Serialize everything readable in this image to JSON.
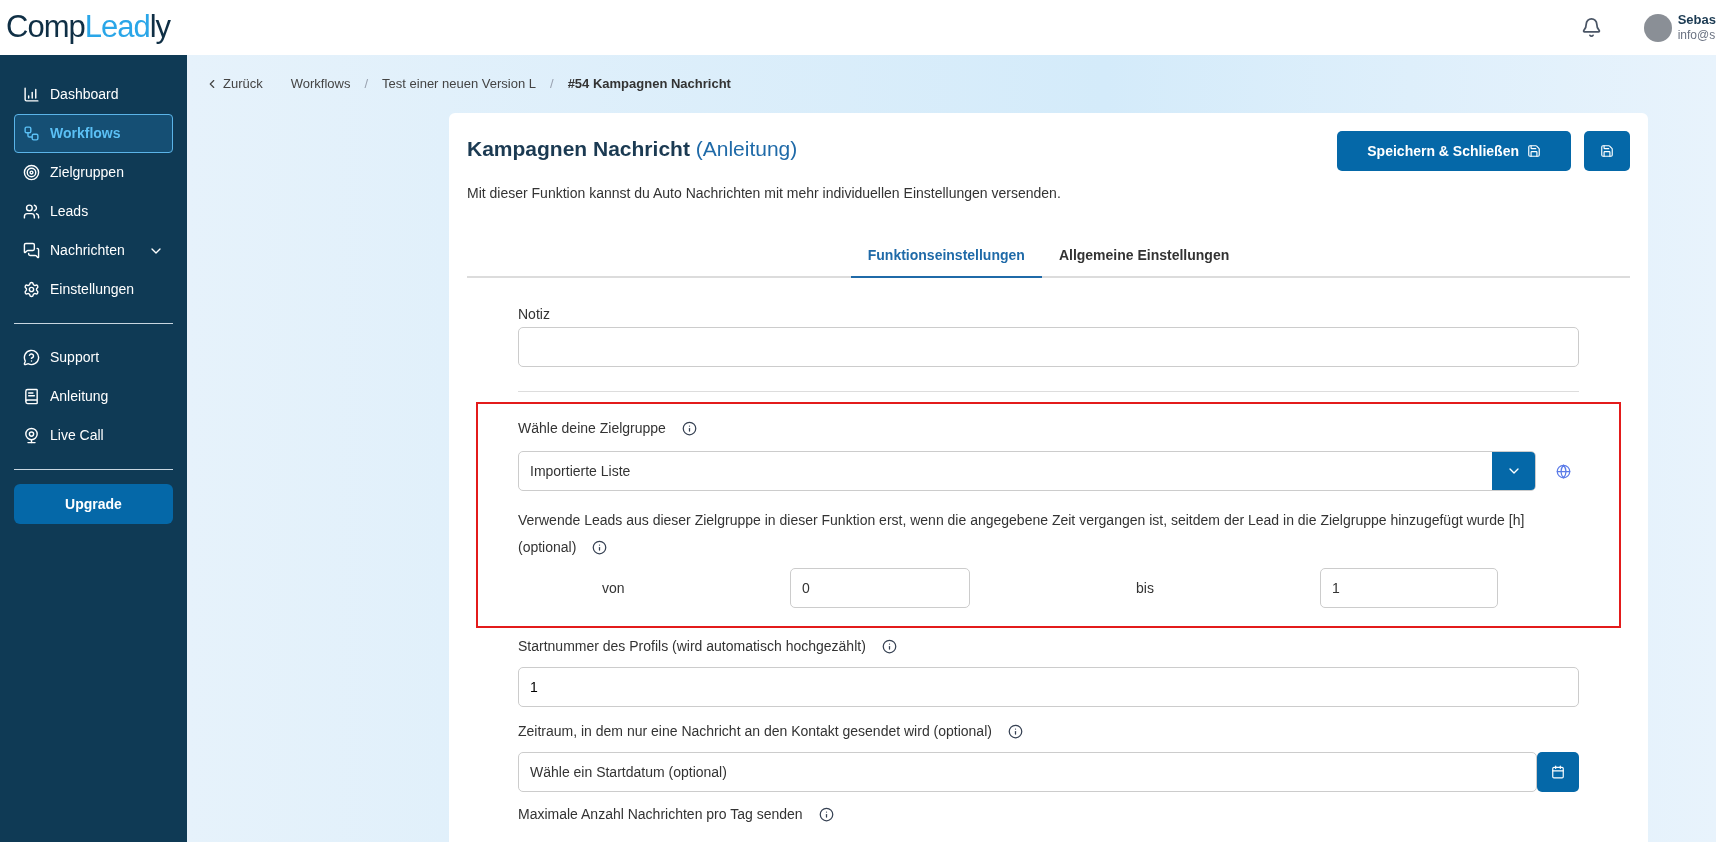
{
  "logo": {
    "part_1": "Comp",
    "part_2": "Leadly"
  },
  "header": {
    "user_name": "Sebas",
    "user_email": "info@s"
  },
  "sidebar": {
    "items": [
      {
        "label": "Dashboard",
        "kind": "link",
        "selected": false
      },
      {
        "label": "Workflows",
        "kind": "link",
        "selected": true
      },
      {
        "label": "Zielgruppen",
        "kind": "link",
        "selected": false
      },
      {
        "label": "Leads",
        "kind": "link",
        "selected": false
      },
      {
        "label": "Nachrichten",
        "kind": "group",
        "selected": false
      },
      {
        "label": "Einstellungen",
        "kind": "link",
        "selected": false
      }
    ],
    "help_items": [
      {
        "label": "Support",
        "selected": false
      },
      {
        "label": "Anleitung",
        "selected": false
      },
      {
        "label": "Live Call",
        "selected": false
      }
    ],
    "upgrade_button": "Upgrade"
  },
  "breadcrumb": {
    "back": "Zurück",
    "separator": "/",
    "items": [
      {
        "label": "Workflows",
        "current": false
      },
      {
        "label": "Test einer neuen Version L",
        "current": false
      },
      {
        "label": "#54 Kampagnen Nachricht",
        "current": true
      }
    ]
  },
  "card": {
    "title": "Kampagnen Nachricht",
    "title_link": "(Anleitung)",
    "save_close_button": "Speichern & Schließen",
    "description": "Mit dieser Funktion kannst du Auto Nachrichten mit mehr individuellen Einstellungen versenden.",
    "tabs": [
      {
        "label": "Funktionseinstellungen",
        "selected": true
      },
      {
        "label": "Allgemeine Einstellungen",
        "selected": false
      }
    ]
  },
  "form": {
    "note": {
      "label": "Notiz"
    },
    "audience_section": {
      "highlighted": true,
      "audience": {
        "label": "Wähle deine Zielgruppe",
        "value": "Importierte Liste"
      },
      "delay": {
        "label": "Verwende Leads aus dieser Zielgruppe in dieser Funktion erst, wenn die angegebene Zeit vergangen ist, seitdem der Lead in die Zielgruppe hinzugefügt wurde [h]",
        "label_2": "(optional)",
        "from_label": "von",
        "from_value": "0",
        "to_label": "bis",
        "to_value": "1"
      }
    },
    "start_number": {
      "label": "Startnummer des Profils (wird automatisch hochgezählt)",
      "value": "1"
    },
    "period": {
      "label": "Zeitraum, in dem nur eine Nachricht an den Kontakt gesendet wird (optional)",
      "placeholder": "Wähle ein Startdatum (optional)"
    },
    "max_per_day": {
      "label": "Maximale Anzahl Nachrichten pro Tag senden"
    }
  }
}
